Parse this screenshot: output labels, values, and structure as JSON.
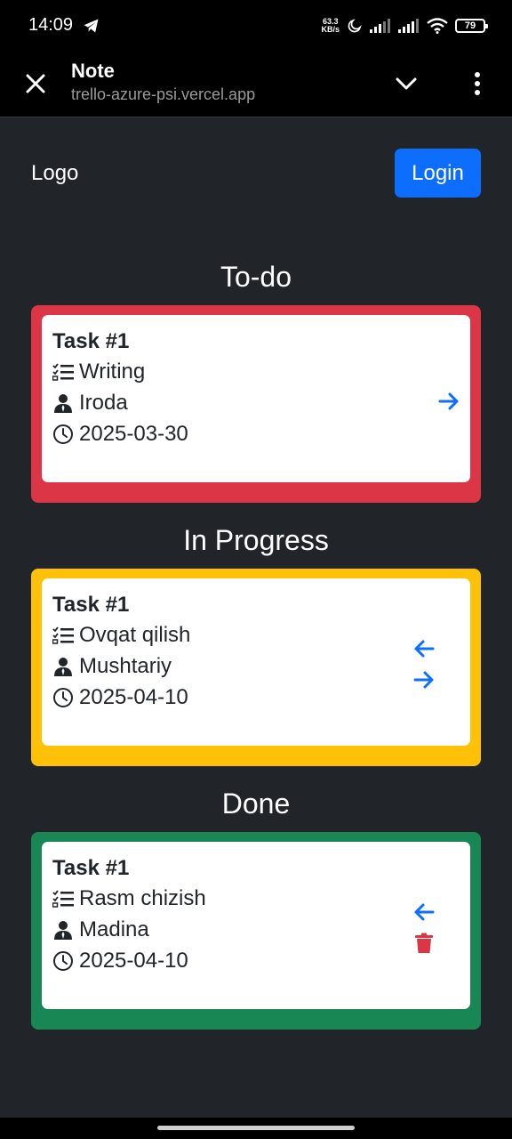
{
  "status_bar": {
    "time": "14:09",
    "net_speed_value": "63.3",
    "net_speed_unit": "KB/s",
    "battery": "79"
  },
  "app_bar": {
    "title": "Note",
    "url": "trello-azure-psi.vercel.app"
  },
  "navbar": {
    "logo": "Logo",
    "login_label": "Login"
  },
  "colors": {
    "todo": "#dc3545",
    "in_progress": "#ffc107",
    "done": "#198754",
    "primary": "#0d6efd"
  },
  "columns": [
    {
      "title": "To-do",
      "card": {
        "title": "Task #1",
        "task": "Writing",
        "user": "Iroda",
        "date": "2025-03-30",
        "actions": [
          "arrow-right-icon"
        ]
      }
    },
    {
      "title": "In Progress",
      "card": {
        "title": "Task #1",
        "task": "Ovqat qilish",
        "user": "Mushtariy",
        "date": "2025-04-10",
        "actions": [
          "arrow-left-icon",
          "arrow-right-icon"
        ]
      }
    },
    {
      "title": "Done",
      "card": {
        "title": "Task #1",
        "task": "Rasm chizish",
        "user": "Madina",
        "date": "2025-04-10",
        "actions": [
          "arrow-left-icon",
          "trash-icon"
        ]
      }
    }
  ]
}
